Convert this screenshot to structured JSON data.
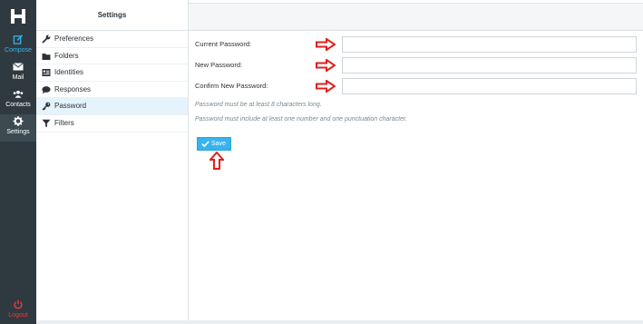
{
  "rail": {
    "logo_icon": "hm-logo-icon",
    "items": [
      {
        "label": "Compose",
        "icon": "compose-icon"
      },
      {
        "label": "Mail",
        "icon": "envelope-icon"
      },
      {
        "label": "Contacts",
        "icon": "users-icon"
      },
      {
        "label": "Settings",
        "icon": "gear-icon"
      }
    ],
    "logout": {
      "label": "Logout",
      "icon": "power-icon"
    }
  },
  "panel": {
    "title": "Settings",
    "items": [
      {
        "label": "Preferences",
        "icon": "wrench-icon"
      },
      {
        "label": "Folders",
        "icon": "folder-icon"
      },
      {
        "label": "Identities",
        "icon": "id-card-icon"
      },
      {
        "label": "Responses",
        "icon": "comment-icon"
      },
      {
        "label": "Password",
        "icon": "key-icon",
        "active": true
      },
      {
        "label": "Filters",
        "icon": "filter-icon"
      }
    ]
  },
  "form": {
    "current_label": "Current Password:",
    "new_label": "New Password:",
    "confirm_label": "Confirm New Password:",
    "current_value": "",
    "new_value": "",
    "confirm_value": "",
    "hint_length": "Password must be at least 8 characters long.",
    "hint_chars": "Password must include at least one number and one punctuation character.",
    "save_label": "Save"
  },
  "colors": {
    "rail_bg": "#2f3a40",
    "accent": "#37b4f0",
    "annotation_arrow": "#e0201e",
    "logout": "#e23b3b"
  }
}
